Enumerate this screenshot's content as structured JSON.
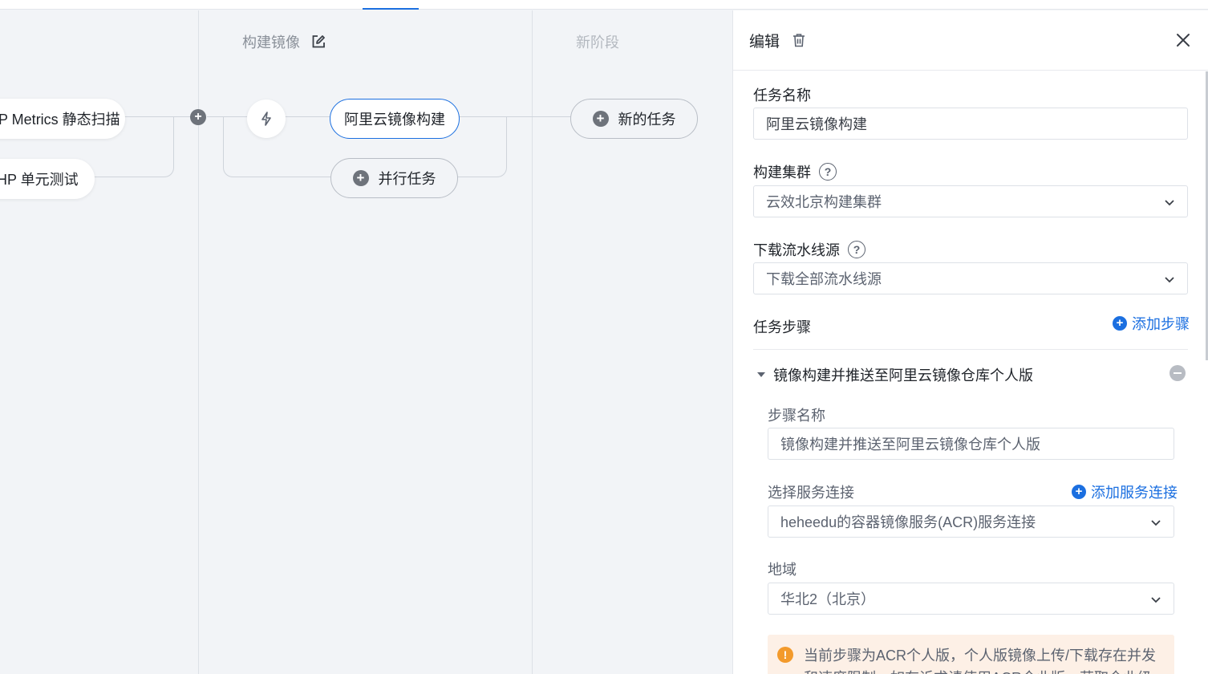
{
  "canvas": {
    "stages": [
      {
        "title": "构建镜像"
      },
      {
        "title": "新阶段"
      }
    ],
    "prev_stage_tasks": [
      "P Metrics 静态扫描",
      "HP 单元测试"
    ],
    "build_stage": {
      "selected_task": "阿里云镜像构建",
      "add_parallel_label": "并行任务"
    },
    "new_stage": {
      "add_task_label": "新的任务"
    }
  },
  "panel": {
    "title": "编辑",
    "task_name": {
      "label": "任务名称",
      "value": "阿里云镜像构建"
    },
    "build_cluster": {
      "label": "构建集群",
      "value": "云效北京构建集群"
    },
    "download_source": {
      "label": "下载流水线源",
      "value": "下载全部流水线源"
    },
    "task_steps": {
      "label": "任务步骤",
      "add_label": "添加步骤"
    },
    "step": {
      "title": "镜像构建并推送至阿里云镜像仓库个人版",
      "step_name": {
        "label": "步骤名称",
        "value": "镜像构建并推送至阿里云镜像仓库个人版"
      },
      "service_connection": {
        "label": "选择服务连接",
        "add_label": "添加服务连接",
        "value": "heheedu的容器镜像服务(ACR)服务连接"
      },
      "region": {
        "label": "地域",
        "value": "华北2（北京）"
      },
      "warning": {
        "line1": "当前步骤为ACR个人版，个人版镜像上传/下载存在并发",
        "line2": "和速度限制，如有诉求请使用ACR企业版，获取企业级"
      }
    }
  },
  "colors": {
    "accent": "#1b6fe0",
    "warning": "#f39a2b",
    "warning_bg": "#fdf0e6"
  }
}
